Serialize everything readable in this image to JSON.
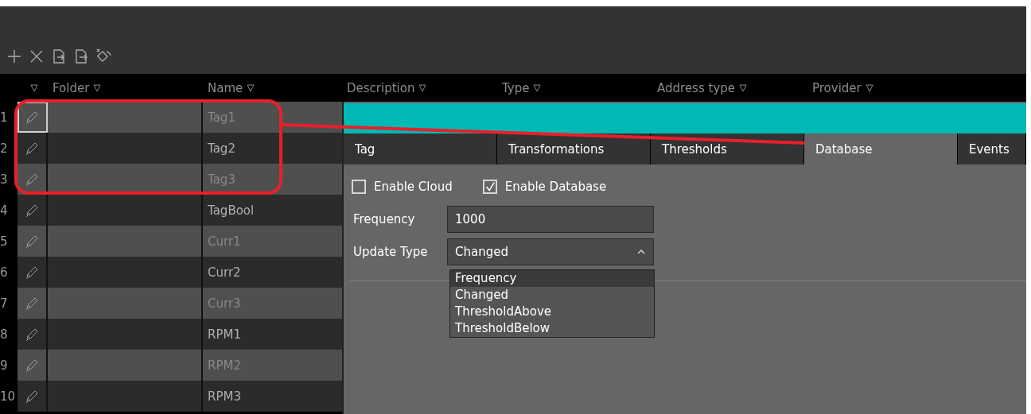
{
  "table": {
    "columns": [
      {
        "label": "Folder"
      },
      {
        "label": "Name"
      },
      {
        "label": "Description"
      },
      {
        "label": "Type"
      },
      {
        "label": "Address type"
      },
      {
        "label": "Provider"
      }
    ],
    "rows": [
      {
        "number": "1",
        "name": "Tag1",
        "selected": true
      },
      {
        "number": "2",
        "name": "Tag2",
        "selected": false
      },
      {
        "number": "3",
        "name": "Tag3",
        "selected": false
      },
      {
        "number": "4",
        "name": "TagBool",
        "selected": false
      },
      {
        "number": "5",
        "name": "Curr1",
        "selected": false
      },
      {
        "number": "6",
        "name": "Curr2",
        "selected": false
      },
      {
        "number": "7",
        "name": "Curr3",
        "selected": false
      },
      {
        "number": "8",
        "name": "RPM1",
        "selected": false
      },
      {
        "number": "9",
        "name": "RPM2",
        "selected": false
      },
      {
        "number": "10",
        "name": "RPM3",
        "selected": false
      }
    ]
  },
  "detail": {
    "tabs": [
      {
        "label": "Tag",
        "selected": false
      },
      {
        "label": "Transformations",
        "selected": false
      },
      {
        "label": "Thresholds",
        "selected": false
      },
      {
        "label": "Database",
        "selected": true
      },
      {
        "label": "Events",
        "selected": false
      }
    ],
    "checkboxes": [
      {
        "label": "Enable Cloud",
        "checked": false
      },
      {
        "label": "Enable Database",
        "checked": true
      }
    ],
    "fields": [
      {
        "kind": "text",
        "label": "Frequency",
        "value": "1000"
      },
      {
        "kind": "dropdown",
        "label": "Update Type",
        "value": "Changed",
        "expanded": true,
        "options": [
          {
            "label": "Frequency",
            "highlighted": true
          },
          {
            "label": "Changed",
            "highlighted": false
          },
          {
            "label": "ThresholdAbove",
            "highlighted": false
          },
          {
            "label": "ThresholdBelow",
            "highlighted": false
          }
        ]
      }
    ]
  }
}
